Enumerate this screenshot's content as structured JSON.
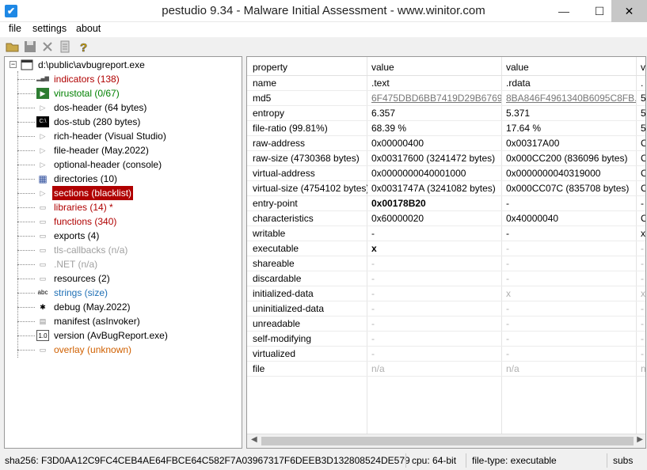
{
  "window": {
    "title": "pestudio 9.34 - Malware Initial Assessment - www.winitor.com",
    "minimize": "—",
    "maximize": "☐",
    "close": "✕"
  },
  "menu": [
    "file",
    "settings",
    "about"
  ],
  "tree": {
    "root": "d:\\public\\avbugreport.exe",
    "items": [
      {
        "label": "indicators (138)",
        "color": "#b00000",
        "icon": "bar-chart-icon"
      },
      {
        "label": "virustotal (0/67)",
        "color": "#008000",
        "icon": "virustotal-icon"
      },
      {
        "label": "dos-header (64 bytes)",
        "color": "#000000",
        "icon": "expand-arrow-icon"
      },
      {
        "label": "dos-stub (280 bytes)",
        "color": "#000000",
        "icon": "console-icon"
      },
      {
        "label": "rich-header (Visual Studio)",
        "color": "#000000",
        "icon": "expand-arrow-icon"
      },
      {
        "label": "file-header (May.2022)",
        "color": "#000000",
        "icon": "expand-arrow-icon"
      },
      {
        "label": "optional-header (console)",
        "color": "#000000",
        "icon": "expand-arrow-icon"
      },
      {
        "label": "directories (10)",
        "color": "#000000",
        "icon": "grid-icon"
      },
      {
        "label": "sections (blacklist)",
        "color": "#ffffff",
        "icon": "expand-arrow-icon",
        "selected": true
      },
      {
        "label": "libraries (14) *",
        "color": "#b00000",
        "icon": "library-icon"
      },
      {
        "label": "functions (340)",
        "color": "#b00000",
        "icon": "function-icon"
      },
      {
        "label": "exports (4)",
        "color": "#000000",
        "icon": "export-icon"
      },
      {
        "label": "tls-callbacks (n/a)",
        "color": "#a0a0a0",
        "icon": "callback-icon"
      },
      {
        "label": ".NET (n/a)",
        "color": "#a0a0a0",
        "icon": "dotnet-icon"
      },
      {
        "label": "resources (2)",
        "color": "#000000",
        "icon": "resource-icon"
      },
      {
        "label": "strings (size)",
        "color": "#1e6fb5",
        "icon": "strings-icon",
        "icon_text": "abc"
      },
      {
        "label": "debug (May.2022)",
        "color": "#000000",
        "icon": "bug-icon"
      },
      {
        "label": "manifest (asInvoker)",
        "color": "#000000",
        "icon": "manifest-icon"
      },
      {
        "label": "version (AvBugReport.exe)",
        "color": "#000000",
        "icon": "version-icon",
        "icon_text": "1.0"
      },
      {
        "label": "overlay (unknown)",
        "color": "#d06000",
        "icon": "overlay-icon"
      }
    ]
  },
  "table": {
    "headers": [
      "property",
      "value",
      "value",
      "v"
    ],
    "rows": [
      {
        "p": "name",
        "v1": ".text",
        "v2": ".rdata",
        "v3": "."
      },
      {
        "p": "md5",
        "v1": "6F475DBD6BB7419D29B6769...",
        "v2": "8BA846F4961340B6095C8FB...",
        "v3": "5",
        "style": "link"
      },
      {
        "p": "entropy",
        "v1": "6.357",
        "v2": "5.371",
        "v3": "5"
      },
      {
        "p": "file-ratio (99.81%)",
        "v1": "68.39 %",
        "v2": "17.64 %",
        "v3": "5"
      },
      {
        "p": "raw-address",
        "v1": "0x00000400",
        "v2": "0x00317A00",
        "v3": "C"
      },
      {
        "p": "raw-size (4730368 bytes)",
        "v1": "0x00317600 (3241472 bytes)",
        "v2": "0x000CC200 (836096 bytes)",
        "v3": "C"
      },
      {
        "p": "virtual-address",
        "v1": "0x0000000040001000",
        "v2": "0x0000000040319000",
        "v3": "C"
      },
      {
        "p": "virtual-size (4754102 bytes)",
        "v1": "0x0031747A (3241082 bytes)",
        "v2": "0x000CC07C (835708 bytes)",
        "v3": "C"
      },
      {
        "p": "entry-point",
        "v1": "0x00178B20",
        "v2": "-",
        "v3": "-",
        "bold": true
      },
      {
        "p": "characteristics",
        "v1": "0x60000020",
        "v2": "0x40000040",
        "v3": "C"
      },
      {
        "p": "writable",
        "v1": "-",
        "v2": "-",
        "v3": "x"
      },
      {
        "p": "executable",
        "v1": "x",
        "v2": "-",
        "v3": "-",
        "v2dim": true,
        "v3dim": true
      },
      {
        "p": "shareable",
        "v1": "-",
        "v2": "-",
        "v3": "-",
        "dim": true
      },
      {
        "p": "discardable",
        "v1": "-",
        "v2": "-",
        "v3": "-",
        "dim": true
      },
      {
        "p": "initialized-data",
        "v1": "-",
        "v2": "x",
        "v3": "x",
        "dim": true
      },
      {
        "p": "uninitialized-data",
        "v1": "-",
        "v2": "-",
        "v3": "-",
        "dim": true
      },
      {
        "p": "unreadable",
        "v1": "-",
        "v2": "-",
        "v3": "-",
        "dim": true
      },
      {
        "p": "self-modifying",
        "v1": "-",
        "v2": "-",
        "v3": "-",
        "dim": true
      },
      {
        "p": "virtualized",
        "v1": "-",
        "v2": "-",
        "v3": "-",
        "dim": true
      },
      {
        "p": "file",
        "v1": "n/a",
        "v2": "n/a",
        "v3": "n",
        "dim": true
      }
    ]
  },
  "status": {
    "sha256": "sha256: F3D0AA12C9FC4CEB4AE64FBCE64C582F7A03967317F6DEEB3D132808524DE579",
    "cpu": "cpu: 64-bit",
    "filetype": "file-type: executable",
    "subsystem": "subs"
  },
  "colors": {
    "selection": "#b00000",
    "accent": "#1e88e5"
  }
}
